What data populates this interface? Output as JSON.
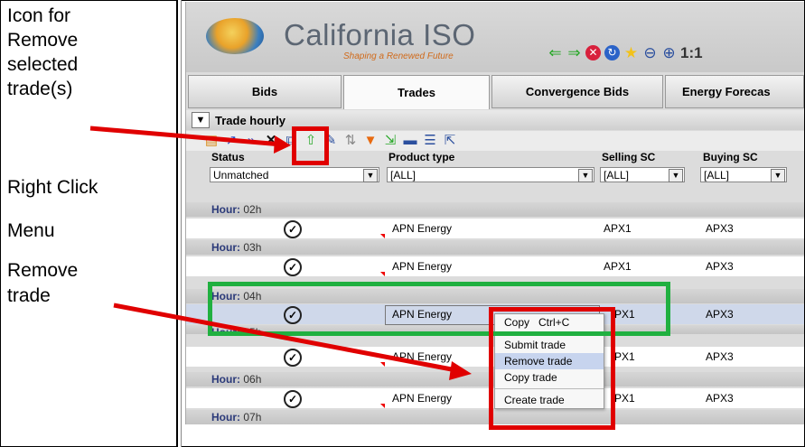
{
  "annotations": {
    "icon_note": [
      "Icon for",
      "Remove",
      "selected",
      "trade(s)"
    ],
    "right_click": "Right Click",
    "menu": "Menu",
    "remove": "Remove",
    "trade": "trade"
  },
  "header": {
    "logo_text": "California ISO",
    "logo_subtitle": "Shaping a Renewed Future",
    "zoom_label": "1:1",
    "nav_icons": [
      "back-arrow-icon",
      "forward-arrow-icon",
      "stop-icon",
      "refresh-icon",
      "favorite-star-icon",
      "zoom-out-icon",
      "zoom-in-icon"
    ]
  },
  "tabs": [
    "Bids",
    "Trades",
    "Convergence Bids",
    "Energy Forecas"
  ],
  "active_tab": "Trades",
  "panel": {
    "title": "Trade hourly"
  },
  "toolbar_icons": [
    "import-icon",
    "submit-icon",
    "submit-all-icon",
    "remove-icon",
    "copy-icon",
    "upload-icon",
    "edit-icon",
    "sort-icon",
    "filter-icon",
    "export-icon",
    "print-icon",
    "columns-icon",
    "popout-icon"
  ],
  "columns": {
    "status": "Status",
    "product_type": "Product type",
    "selling_sc": "Selling SC",
    "buying_sc": "Buying SC"
  },
  "filters": {
    "status": "Unmatched",
    "product_type": "[ALL]",
    "selling_sc": "[ALL]",
    "buying_sc": "[ALL]"
  },
  "hour_prefix": "Hour:",
  "rows": [
    {
      "hour": "02h",
      "product": "APN Energy",
      "selling": "APX1",
      "buying": "APX3"
    },
    {
      "hour": "03h",
      "product": "APN Energy",
      "selling": "APX1",
      "buying": "APX3"
    },
    {
      "hour": "04h",
      "product": "APN Energy",
      "selling": "PX1",
      "buying": "APX3"
    },
    {
      "hour": "05h",
      "product": "APN Energy",
      "selling": "PX1",
      "buying": "APX3"
    },
    {
      "hour": "06h",
      "product": "APN Energy",
      "selling": "PX1",
      "buying": "APX3"
    }
  ],
  "last_hour": "07h",
  "context_menu": {
    "copy": "Copy   Ctrl+C",
    "submit": "Submit trade",
    "remove": "Remove trade",
    "copy_trade": "Copy trade",
    "create": "Create trade"
  },
  "colors": {
    "highlight_red": "#e00000",
    "highlight_green": "#20b040",
    "selected_row": "#cfd8ea"
  }
}
